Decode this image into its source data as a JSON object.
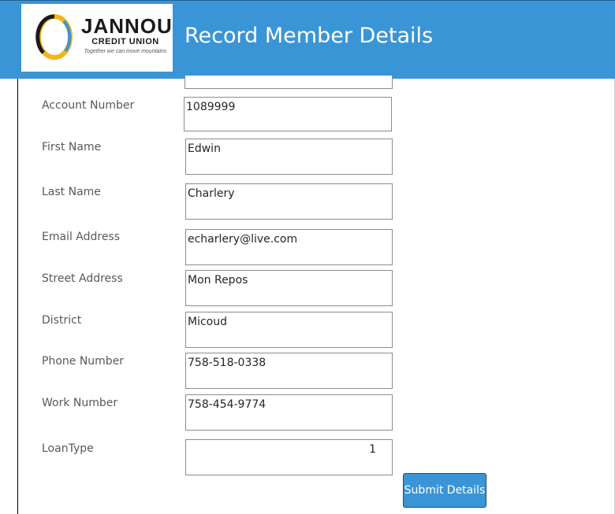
{
  "header": {
    "title": "Record Member Details",
    "brand_color": "#3a95d6",
    "logo": {
      "name": "JANNOU",
      "subtitle": "CREDIT UNION",
      "tagline": "Together we can move mountains"
    }
  },
  "form": {
    "fields": [
      {
        "label": "Account Number",
        "value": "1089999"
      },
      {
        "label": "First Name",
        "value": "Edwin"
      },
      {
        "label": "Last Name",
        "value": "Charlery"
      },
      {
        "label": "Email Address",
        "value": "echarlery@live.com"
      },
      {
        "label": "Street Address",
        "value": "Mon Repos"
      },
      {
        "label": "District",
        "value": "Micoud"
      },
      {
        "label": "Phone Number",
        "value": "758-518-0338"
      },
      {
        "label": "Work Number",
        "value": "758-454-9774"
      },
      {
        "label": "LoanType",
        "value": "1"
      }
    ],
    "submit_label": "Submit Details"
  }
}
